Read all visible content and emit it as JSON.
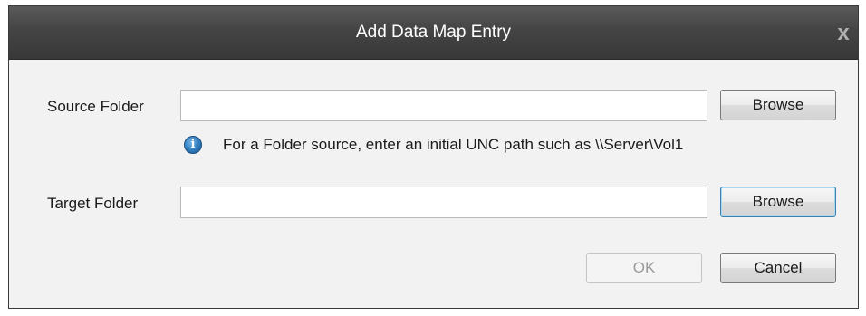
{
  "dialog": {
    "title": "Add Data Map Entry",
    "close_glyph": "x"
  },
  "source": {
    "label": "Source Folder",
    "value": "",
    "browse_label": "Browse"
  },
  "hint": {
    "icon": "info-icon",
    "text": "For a Folder source, enter an initial UNC path such as \\\\Server\\Vol1"
  },
  "target": {
    "label": "Target Folder",
    "value": "",
    "browse_label": "Browse"
  },
  "actions": {
    "ok_label": "OK",
    "ok_enabled": false,
    "cancel_label": "Cancel"
  },
  "colors": {
    "titlebar": "#444444",
    "info_icon": "#2c76b8",
    "focus_border": "#3c7fb1"
  }
}
